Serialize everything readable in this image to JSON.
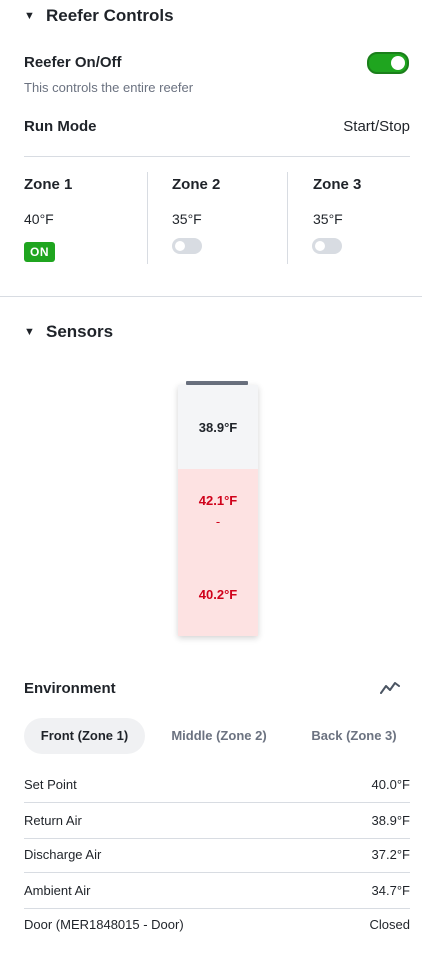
{
  "reefer": {
    "title": "Reefer Controls",
    "caret": "▼",
    "onoff_label": "Reefer On/Off",
    "onoff_sub": "This controls the entire reefer",
    "onoff_state": true,
    "run_mode_label": "Run Mode",
    "run_mode_value": "Start/Stop",
    "zones": [
      {
        "name": "Zone 1",
        "temp": "40°F",
        "state": "ON"
      },
      {
        "name": "Zone 2",
        "temp": "35°F",
        "state": "off"
      },
      {
        "name": "Zone 3",
        "temp": "35°F",
        "state": "off"
      }
    ]
  },
  "sensors": {
    "title": "Sensors",
    "caret": "▼",
    "readings": {
      "top": "38.9°F",
      "middle": "42.1°F",
      "middle_sep": "-",
      "bottom": "40.2°F"
    }
  },
  "environment": {
    "title": "Environment",
    "icon": "trend-chart-icon",
    "tabs": [
      "Front (Zone 1)",
      "Middle (Zone 2)",
      "Back (Zone 3)"
    ],
    "active_tab": 0,
    "rows": [
      {
        "label": "Set Point",
        "value": "40.0°F"
      },
      {
        "label": "Return Air",
        "value": "38.9°F"
      },
      {
        "label": "Discharge Air",
        "value": "37.2°F"
      },
      {
        "label": "Ambient Air",
        "value": "34.7°F"
      },
      {
        "label": "Door (MER1848015 - Door)",
        "value": "Closed"
      }
    ]
  },
  "colors": {
    "accent_green": "#1fa51f",
    "alert_red": "#d0021b",
    "alert_bg": "#fde2e2"
  }
}
